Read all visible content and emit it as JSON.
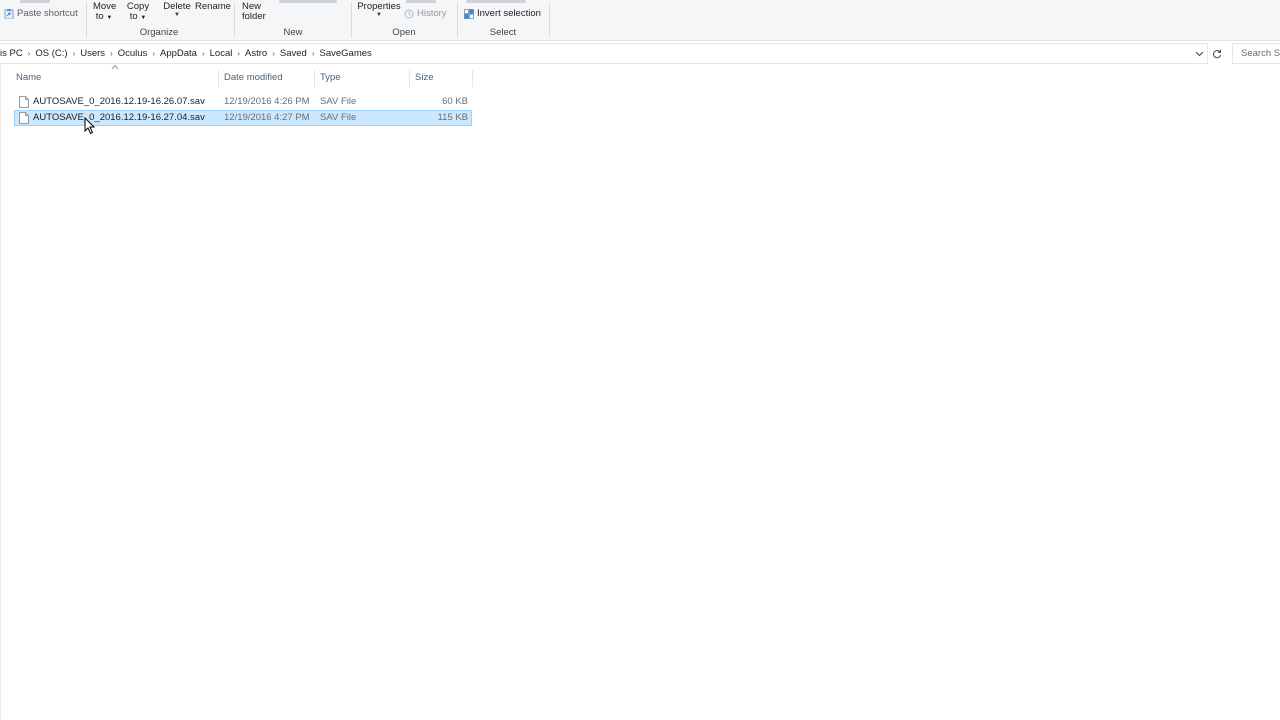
{
  "ribbon": {
    "clipboard": {
      "paste_shortcut": "Paste shortcut"
    },
    "organize": {
      "label": "Organize",
      "move_to": [
        "Move",
        "to"
      ],
      "copy_to": [
        "Copy",
        "to"
      ],
      "delete": "Delete",
      "rename": "Rename"
    },
    "new": {
      "label": "New",
      "new_folder": [
        "New",
        "folder"
      ]
    },
    "open": {
      "label": "Open",
      "properties": "Properties",
      "history": "History"
    },
    "select": {
      "label": "Select",
      "invert_selection": "Invert selection"
    }
  },
  "address": {
    "crumbs": [
      "is PC",
      "OS (C:)",
      "Users",
      "Oculus",
      "AppData",
      "Local",
      "Astro",
      "Saved",
      "SaveGames"
    ],
    "search_placeholder": "Search Sa"
  },
  "columns": {
    "name": "Name",
    "date_modified": "Date modified",
    "type": "Type",
    "size": "Size"
  },
  "files": [
    {
      "name": "AUTOSAVE_0_2016.12.19-16.26.07.sav",
      "date": "12/19/2016 4:26 PM",
      "type": "SAV File",
      "size": "60 KB",
      "selected": false
    },
    {
      "name": "AUTOSAVE_0_2016.12.19-16.27.04.sav",
      "date": "12/19/2016 4:27 PM",
      "type": "SAV File",
      "size": "115 KB",
      "selected": true
    }
  ],
  "colors": {
    "selection_bg": "#cce8ff",
    "selection_border": "#99d1ff",
    "header_text": "#4c607a"
  },
  "icons": {
    "paste_shortcut": "paste-shortcut-icon",
    "history": "history-icon",
    "invert_selection": "invert-selection-icon",
    "file": "file-icon",
    "refresh": "refresh-icon",
    "dropdown": "chevron-down-icon",
    "sort": "sort-ascending-icon"
  }
}
